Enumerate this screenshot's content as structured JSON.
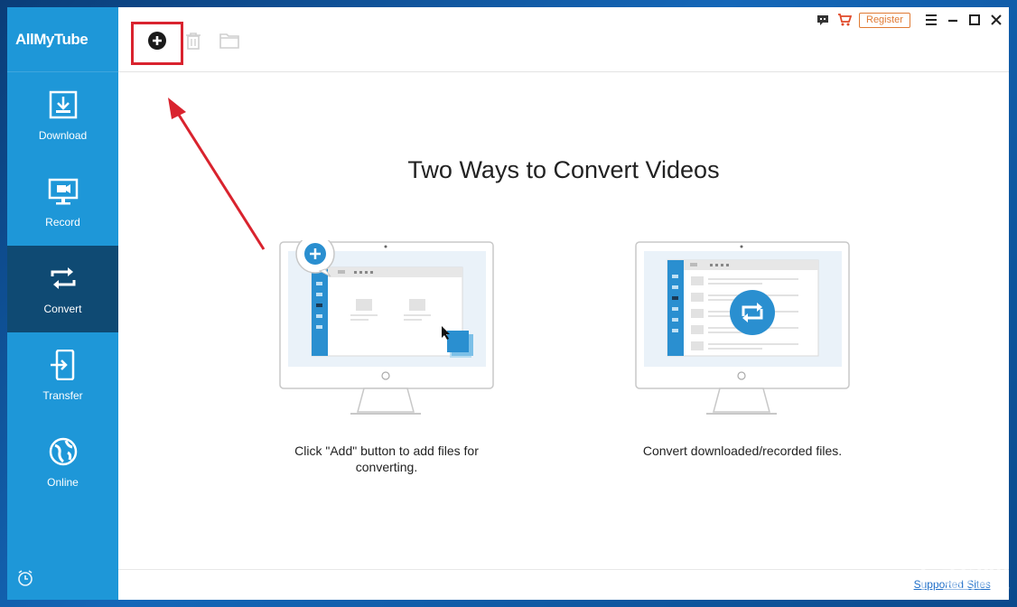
{
  "app": {
    "title": "AllMyTube"
  },
  "sidebar": {
    "items": [
      {
        "label": "Download",
        "icon": "download-icon"
      },
      {
        "label": "Record",
        "icon": "record-icon"
      },
      {
        "label": "Convert",
        "icon": "convert-icon",
        "active": true
      },
      {
        "label": "Transfer",
        "icon": "transfer-icon"
      },
      {
        "label": "Online",
        "icon": "globe-icon"
      }
    ]
  },
  "toolbar": {
    "add_icon": "add-circle-icon",
    "delete_icon": "trash-icon",
    "folder_icon": "folder-icon",
    "register_label": "Register"
  },
  "main": {
    "heading": "Two Ways to Convert Videos",
    "option1_caption_line1": "Click \"Add\" button to add files for",
    "option1_caption_line2": "converting.",
    "option2_caption": "Convert downloaded/recorded files."
  },
  "footer": {
    "supported_sites": "Supported Sites"
  },
  "watermark": "下载吧",
  "colors": {
    "sidebar": "#1e97d8",
    "sidebar_active": "#0f4a73",
    "accent": "#e07a34",
    "highlight": "#d9232e"
  }
}
